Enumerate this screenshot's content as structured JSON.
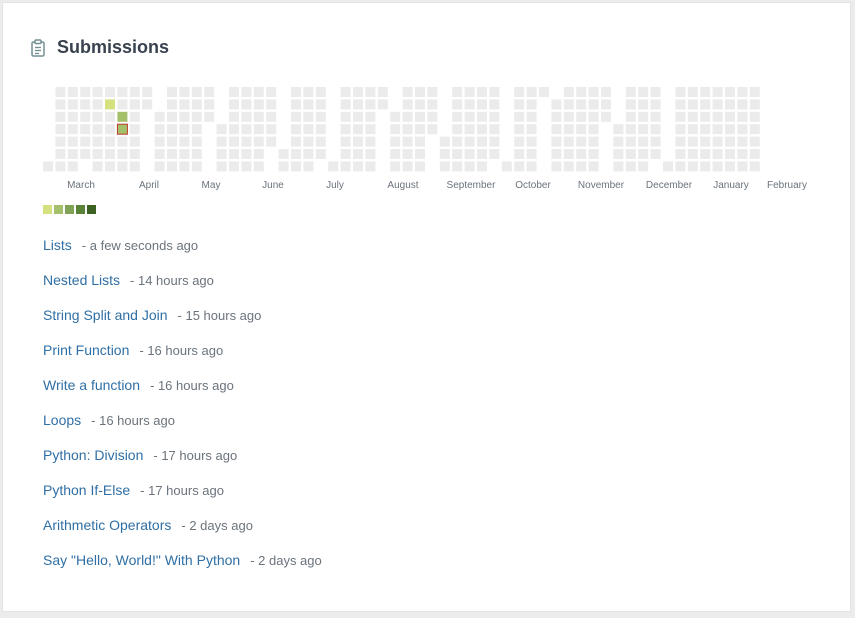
{
  "header": {
    "title": "Submissions",
    "icon": "clipboard-icon"
  },
  "heatmap": {
    "months": [
      "March",
      "April",
      "May",
      "June",
      "July",
      "August",
      "September",
      "October",
      "November",
      "December",
      "January",
      "February"
    ],
    "active": [
      {
        "week": 5,
        "day": 1,
        "level": 1
      },
      {
        "week": 6,
        "day": 2,
        "level": 2
      },
      {
        "week": 6,
        "day": 3,
        "level": 2,
        "highlight": true
      }
    ]
  },
  "legend": {
    "colors": [
      "#d5e07f",
      "#a5c06a",
      "#7fa255",
      "#5a8338",
      "#3b6220"
    ]
  },
  "submissions": [
    {
      "name": "Lists",
      "time": "- a few seconds ago"
    },
    {
      "name": "Nested Lists",
      "time": "- 14 hours ago"
    },
    {
      "name": "String Split and Join",
      "time": "- 15 hours ago"
    },
    {
      "name": "Print Function",
      "time": "- 16 hours ago"
    },
    {
      "name": "Write a function",
      "time": "- 16 hours ago"
    },
    {
      "name": "Loops",
      "time": "- 16 hours ago"
    },
    {
      "name": "Python: Division",
      "time": "- 17 hours ago"
    },
    {
      "name": "Python If-Else",
      "time": "- 17 hours ago"
    },
    {
      "name": "Arithmetic Operators",
      "time": "- 2 days ago"
    },
    {
      "name": "Say \"Hello, World!\" With Python",
      "time": "- 2 days ago"
    }
  ],
  "colors": {
    "empty": "#ebebeb",
    "link": "#2f6fa5",
    "highlight_border": "#c0392b"
  }
}
